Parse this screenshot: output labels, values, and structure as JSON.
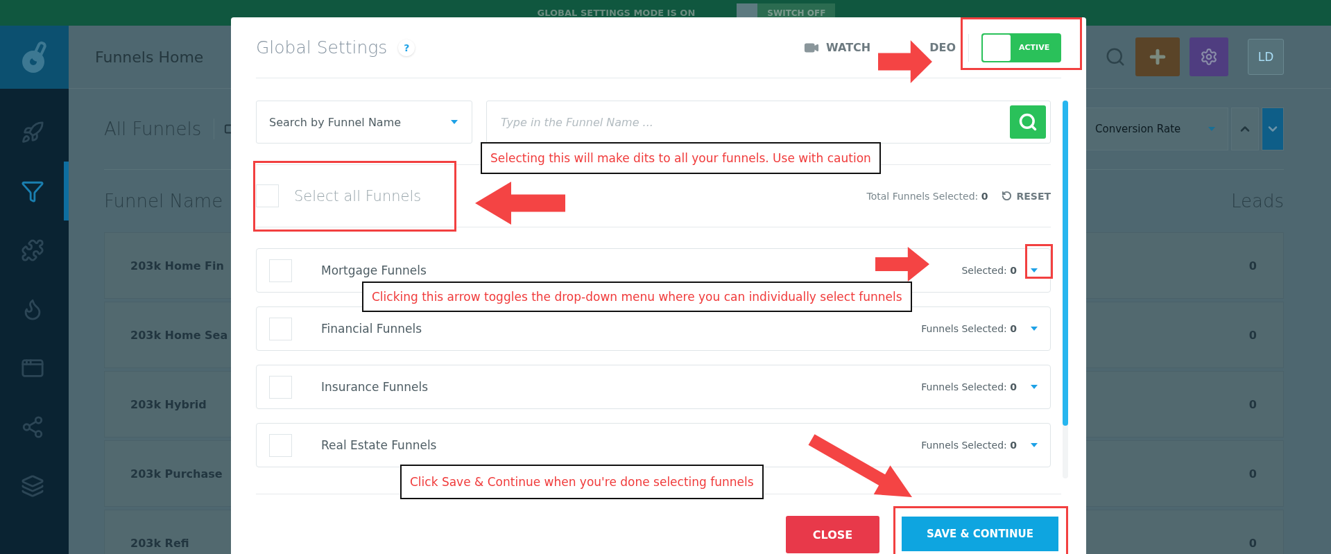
{
  "banner": {
    "text": "GLOBAL SETTINGS MODE IS ON",
    "button": "SWITCH OFF"
  },
  "header": {
    "title": "Funnels Home",
    "avatar": "LD"
  },
  "sidebar": {
    "items": [
      {
        "kind": "rocket",
        "selected": false
      },
      {
        "kind": "funnel",
        "selected": true
      },
      {
        "kind": "puzzle",
        "selected": false
      },
      {
        "kind": "flame",
        "selected": false
      },
      {
        "kind": "windows",
        "selected": false
      },
      {
        "kind": "share",
        "selected": false
      },
      {
        "kind": "layers",
        "selected": false
      }
    ]
  },
  "toolbar": {
    "title": "All Funnels",
    "sort": "Conversion Rate"
  },
  "table": {
    "columns": [
      "Funnel Name",
      "Leads"
    ],
    "rows": [
      {
        "name": "203k Home Fin",
        "leads": "0"
      },
      {
        "name": "203k Home Sea",
        "leads": "0"
      },
      {
        "name": "203k Hybrid",
        "leads": "0"
      },
      {
        "name": "203k Purchase",
        "leads": "0"
      },
      {
        "name": "203k Refi",
        "leads": "0"
      }
    ]
  },
  "modal": {
    "title": "Global Settings",
    "help": "?",
    "video_button": [
      "WATCH",
      "DEO"
    ],
    "toggle": {
      "label": "ACTIVE",
      "on": true
    },
    "search": {
      "select": "Search by Funnel Name",
      "placeholder": "Type in the Funnel Name ..."
    },
    "select_all": {
      "label": "Select all Funnels",
      "checked": false
    },
    "total": {
      "label": "Total Funnels Selected:",
      "count": "0"
    },
    "reset": "RESET",
    "groups": [
      {
        "name": "Mortgage Funnels",
        "checked": false,
        "selected_label": "Selected:",
        "count": "0"
      },
      {
        "name": "Financial Funnels",
        "checked": false,
        "selected_label": "Funnels Selected:",
        "count": "0"
      },
      {
        "name": "Insurance Funnels",
        "checked": false,
        "selected_label": "Funnels Selected:",
        "count": "0"
      },
      {
        "name": "Real Estate Funnels",
        "checked": false,
        "selected_label": "Funnels Selected:",
        "count": "0"
      }
    ],
    "buttons": {
      "close": "CLOSE",
      "save": "SAVE & CONTINUE"
    }
  },
  "callouts": [
    "Selecting this will make dits to all your funnels. Use with caution",
    "Clicking this arrow toggles the drop-down menu where you can individually select funnels",
    "Click Save & Continue when you're done selecting funnels"
  ]
}
